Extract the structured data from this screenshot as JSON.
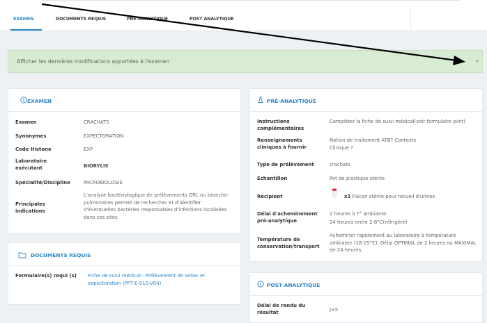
{
  "tabs": [
    {
      "label": "EXAMEN",
      "active": true
    },
    {
      "label": "DOCUMENTS REQUIS",
      "active": false
    },
    {
      "label": "PRÉ-ANALYTIQUE",
      "active": false
    },
    {
      "label": "POST ANALYTIQUE",
      "active": false
    }
  ],
  "banner": {
    "text": "Afficher les dernières modifications apportées à l'examen",
    "chevron_icon": "chevron-down-icon"
  },
  "examen": {
    "title": "EXAMEN",
    "rows": [
      {
        "label": "Examen",
        "value": "CRACHATS"
      },
      {
        "label": "Synonymes",
        "value": "EXPECTORATION"
      },
      {
        "label": "Code Histone",
        "value": "EXP"
      },
      {
        "label": "Laboratoire exécutant",
        "value": "BIORYLIS"
      },
      {
        "label": "Spécialité/Discipline",
        "value": "MICROBIOLOGIE"
      },
      {
        "label": "Principales indications",
        "value": "L'analyse bactériologique de prélèvements ORL ou broncho-pulmonaires permet de rechercher et d'identifier d'éventuelles bactéries responsables d'infections localisées dans ces sites"
      }
    ]
  },
  "documents": {
    "title": "DOCUMENTS REQUIS",
    "label": "Formulaire(s) requi (s)",
    "link": "Fiche de suivi médical - Prélèvement de selles et expectoration (PPT-E-010-V04)"
  },
  "pre": {
    "title": "PRÉ-ANALYTIQUE",
    "rows": [
      {
        "label": "Instructions complémentaires",
        "value": "Compléter la fiche de suivi médical(voir formulaire joint)"
      },
      {
        "label": "Renseignements cliniques à fournir",
        "value": "Notion de traitement ATB? Contexte Clinique ?"
      },
      {
        "label": "Type de prélèvement",
        "value": "crachats"
      },
      {
        "label": "Echantillon",
        "value": "Pot de plastique stérile"
      },
      {
        "label": "Récipient",
        "qty": "x1",
        "value": "Flacon stérile pour recueil d'urines"
      },
      {
        "label": "Délai d'acheminement pré-analytique",
        "value": "2 heures à T° ambiante",
        "value2": "24 heures entre 2-8°C(réfrigéré)"
      },
      {
        "label": "Température de conservation/transport",
        "value": "Acheminer rapidement au laboratoire à température ambiante (18-25°C). Délai OPTIMAL de 2 heures ou MAXIMAL de 24 heures."
      }
    ]
  },
  "post": {
    "title": "POST ANALYTIQUE",
    "rows": [
      {
        "label": "Délai de rendu du résultat",
        "value": "J+5"
      }
    ]
  },
  "colors": {
    "accent": "#2a86c8",
    "banner_bg": "#d9ecd3",
    "container_red": "#d62b3a"
  }
}
